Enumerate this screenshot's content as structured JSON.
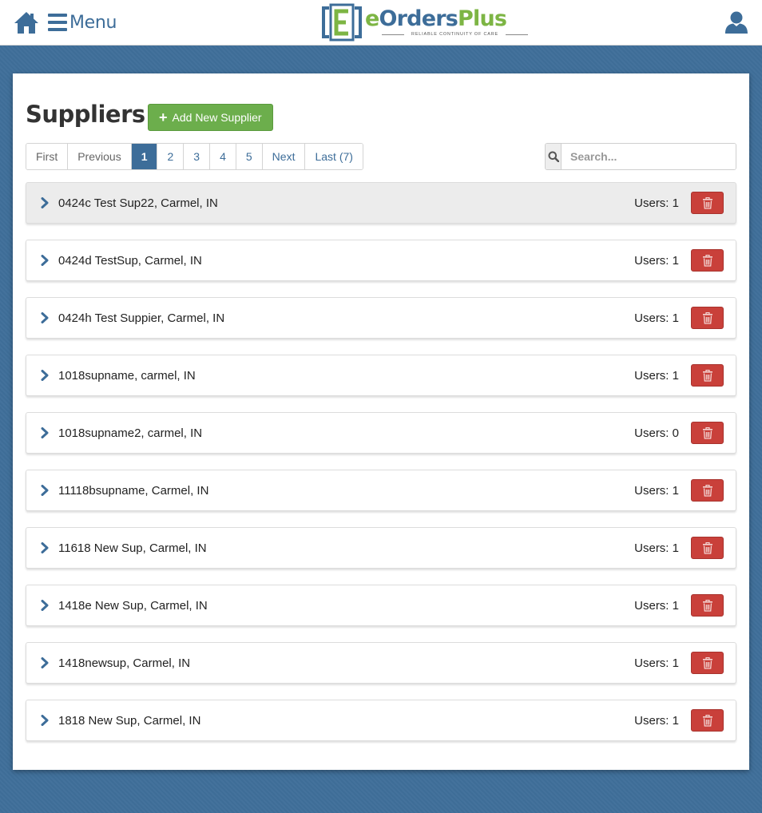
{
  "header": {
    "menu_label": "Menu",
    "logo": {
      "e": "e",
      "orders": "Orders",
      "plus": "Plus",
      "tagline": "RELIABLE CONTINUITY OF CARE",
      "mark_letter": "E"
    },
    "icons": {
      "home": "home-icon",
      "menu": "hamburger-icon",
      "user": "user-icon"
    }
  },
  "colors": {
    "brand_blue": "#3d6d99",
    "brand_green": "#7db544",
    "add_button": "#6cae4c",
    "delete_button": "#c9403a",
    "background": "#3f6f9a"
  },
  "main": {
    "title": "Suppliers",
    "add_button_label": "Add New Supplier",
    "pagination": {
      "first": "First",
      "previous": "Previous",
      "pages": [
        "1",
        "2",
        "3",
        "4",
        "5"
      ],
      "active_page": "1",
      "next": "Next",
      "last": "Last (7)"
    },
    "search": {
      "placeholder": "Search..."
    },
    "suppliers": [
      {
        "name": "0424c Test Sup22, Carmel, IN",
        "users": "Users: 1"
      },
      {
        "name": "0424d TestSup, Carmel, IN",
        "users": "Users: 1"
      },
      {
        "name": "0424h Test Suppier, Carmel, IN",
        "users": "Users: 1"
      },
      {
        "name": "1018supname, carmel, IN",
        "users": "Users: 1"
      },
      {
        "name": "1018supname2, carmel, IN",
        "users": "Users: 0"
      },
      {
        "name": "11118bsupname, Carmel, IN",
        "users": "Users: 1"
      },
      {
        "name": "11618 New Sup, Carmel, IN",
        "users": "Users: 1"
      },
      {
        "name": "1418e New Sup, Carmel, IN",
        "users": "Users: 1"
      },
      {
        "name": "1418newsup, Carmel, IN",
        "users": "Users: 1"
      },
      {
        "name": "1818 New Sup, Carmel, IN",
        "users": "Users: 1"
      }
    ]
  }
}
